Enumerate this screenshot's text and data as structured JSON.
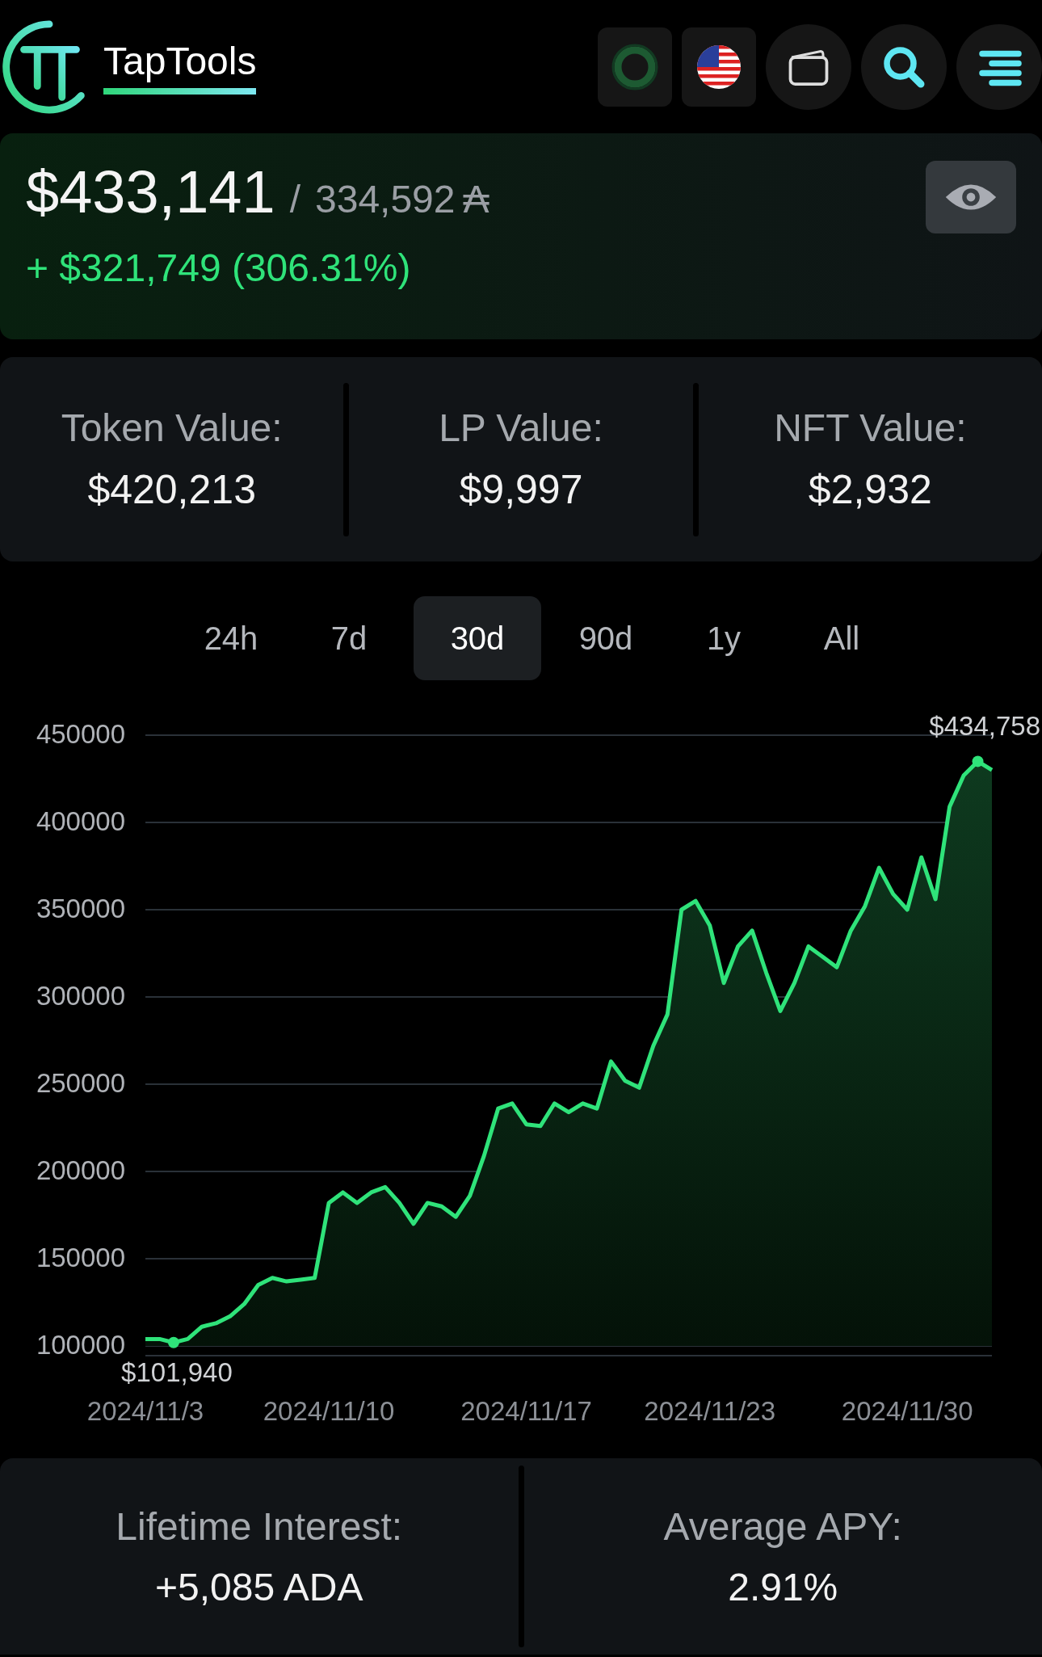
{
  "header": {
    "logo_text": "TapTools"
  },
  "portfolio": {
    "value": "$433,141",
    "separator": "/",
    "ada_value": "334,592",
    "ada_symbol": "₳",
    "change": "+ $321,749 (306.31%)"
  },
  "breakdown": [
    {
      "label": "Token Value:",
      "value": "$420,213"
    },
    {
      "label": "LP Value:",
      "value": "$9,997"
    },
    {
      "label": "NFT Value:",
      "value": "$2,932"
    }
  ],
  "ranges": [
    {
      "label": "24h",
      "selected": false
    },
    {
      "label": "7d",
      "selected": false
    },
    {
      "label": "30d",
      "selected": true
    },
    {
      "label": "90d",
      "selected": false
    },
    {
      "label": "1y",
      "selected": false
    },
    {
      "label": "All",
      "selected": false
    }
  ],
  "chart_data": {
    "type": "area",
    "categories": [
      "2024/11/3",
      null,
      null,
      null,
      null,
      null,
      null,
      null,
      null,
      null,
      null,
      null,
      null,
      "2024/11/10",
      null,
      null,
      null,
      null,
      null,
      null,
      null,
      null,
      null,
      null,
      null,
      null,
      null,
      "2024/11/17",
      null,
      null,
      null,
      null,
      null,
      null,
      null,
      null,
      null,
      null,
      null,
      null,
      "2024/11/23",
      null,
      null,
      null,
      null,
      null,
      null,
      null,
      null,
      null,
      null,
      null,
      null,
      null,
      "2024/11/30",
      null,
      null,
      null,
      null,
      null,
      null
    ],
    "series": [
      {
        "color": "#2fe37a",
        "values": [
          104000,
          104000,
          102000,
          104000,
          111000,
          113000,
          117000,
          124000,
          135000,
          139000,
          137000,
          138000,
          139000,
          182000,
          188000,
          182000,
          188000,
          191000,
          182000,
          170000,
          182000,
          180000,
          174000,
          186000,
          209000,
          236000,
          239000,
          227000,
          226000,
          239000,
          234000,
          239000,
          236000,
          263000,
          252000,
          248000,
          272000,
          290000,
          350000,
          355000,
          341000,
          308000,
          329000,
          338000,
          314000,
          292000,
          308000,
          329000,
          323000,
          317000,
          338000,
          352000,
          374000,
          359000,
          350000,
          380000,
          356000,
          409000,
          427000,
          435000,
          430000
        ]
      }
    ],
    "ylim": [
      100000,
      450000
    ],
    "yticks": [
      100000,
      150000,
      200000,
      250000,
      300000,
      350000,
      400000,
      450000
    ],
    "grid": true,
    "annotations": [
      "$434,758",
      "$101,940"
    ]
  },
  "stats": [
    {
      "label": "Lifetime Interest:",
      "value": "+5,085 ADA"
    },
    {
      "label": "Average APY:",
      "value": "2.91%"
    }
  ]
}
